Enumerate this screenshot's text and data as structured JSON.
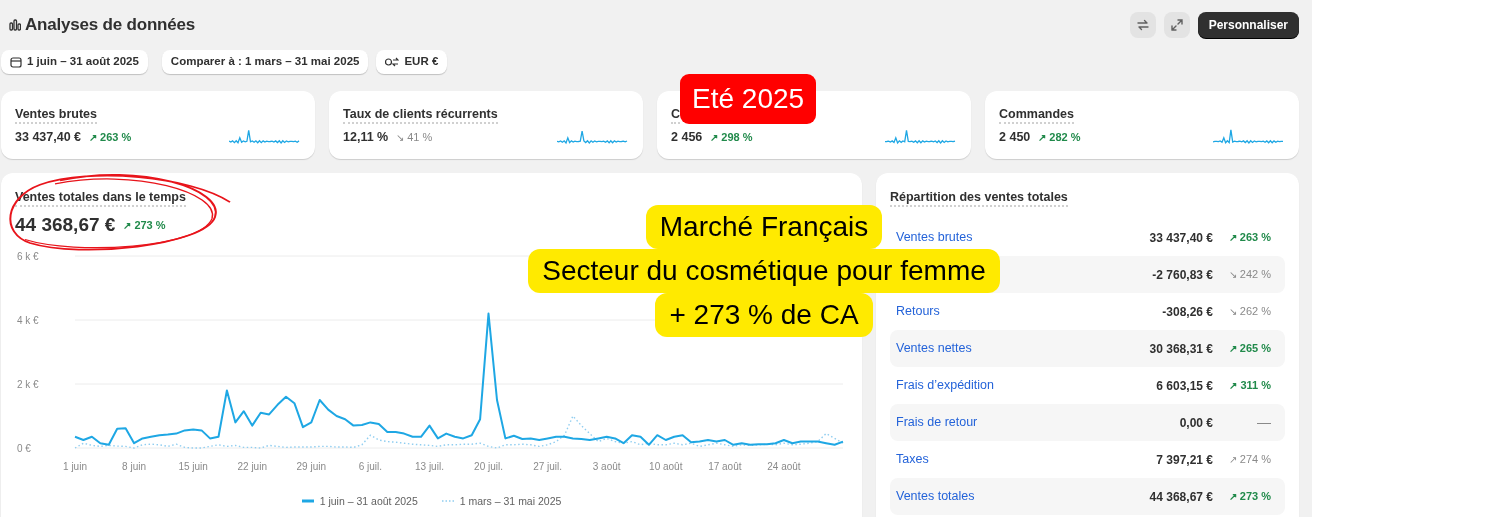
{
  "header": {
    "title": "Analyses de données",
    "action_button": "Personnaliser"
  },
  "filters": [
    {
      "kind": "date",
      "label": "1 juin – 31 août 2025"
    },
    {
      "kind": "plain",
      "label": "Comparer à : 1 mars – 31 mai 2025"
    },
    {
      "kind": "currency",
      "label": "EUR €"
    }
  ],
  "kpis": [
    {
      "title": "Ventes brutes",
      "value": "33 437,40 €",
      "arrow": "↗",
      "change": "263 %",
      "positive": true
    },
    {
      "title": "Taux de clients récurrents",
      "value": "12,11 %",
      "arrow": "↘",
      "change": "41 %",
      "positive": false
    },
    {
      "title": "C",
      "value": "2 456",
      "arrow": "↗",
      "change": "298 %",
      "positive": true
    },
    {
      "title": "Commandes",
      "value": "2 450",
      "arrow": "↗",
      "change": "282 %",
      "positive": true
    }
  ],
  "sales_chart": {
    "title": "Ventes totales dans le temps",
    "value": "44 368,67 €",
    "arrow": "↗",
    "change": "273 %",
    "positive": true,
    "chart_data": {
      "type": "line",
      "ylim": [
        0,
        6000
      ],
      "yticks": [
        {
          "value": 0,
          "label": "0 €"
        },
        {
          "value": 2000,
          "label": "2 k €"
        },
        {
          "value": 4000,
          "label": "4 k €"
        },
        {
          "value": 6000,
          "label": "6 k €"
        }
      ],
      "categories": [
        "1 juin",
        null,
        null,
        null,
        null,
        null,
        null,
        "8 juin",
        null,
        null,
        null,
        null,
        null,
        null,
        "15 juin",
        null,
        null,
        null,
        null,
        null,
        null,
        "22 juin",
        null,
        null,
        null,
        null,
        null,
        null,
        "29 juin",
        null,
        null,
        null,
        null,
        null,
        null,
        "6 juil.",
        null,
        null,
        null,
        null,
        null,
        null,
        "13 juil.",
        null,
        null,
        null,
        null,
        null,
        null,
        "20 juil.",
        null,
        null,
        null,
        null,
        null,
        null,
        "27 juil.",
        null,
        null,
        null,
        null,
        null,
        null,
        "3 août",
        null,
        null,
        null,
        null,
        null,
        null,
        "10 août",
        null,
        null,
        null,
        null,
        null,
        null,
        "17 août",
        null,
        null,
        null,
        null,
        null,
        null,
        "24 août",
        null,
        null,
        null,
        null,
        null,
        null,
        null
      ],
      "series": [
        {
          "name": "1 juin – 31 août 2025",
          "color": "#1ea7e4",
          "values": [
            350,
            250,
            350,
            150,
            100,
            600,
            620,
            150,
            300,
            350,
            400,
            420,
            450,
            550,
            580,
            550,
            300,
            350,
            1800,
            800,
            1150,
            700,
            1100,
            1050,
            1350,
            1600,
            1400,
            650,
            800,
            1500,
            1200,
            1000,
            900,
            700,
            720,
            800,
            750,
            500,
            500,
            450,
            350,
            350,
            700,
            300,
            450,
            350,
            300,
            400,
            900,
            4200,
            1500,
            300,
            380,
            280,
            300,
            250,
            300,
            350,
            350,
            300,
            280,
            250,
            300,
            350,
            300,
            150,
            400,
            350,
            100,
            400,
            250,
            350,
            400,
            180,
            200,
            250,
            200,
            250,
            100,
            150,
            100,
            120,
            120,
            150,
            250,
            150,
            200,
            200,
            200,
            150,
            100,
            200
          ]
        },
        {
          "name": "1 mars – 31 mai 2025",
          "color": "#8fcdf0",
          "line_style": "dotted",
          "values": [
            0,
            150,
            80,
            50,
            80,
            60,
            50,
            0,
            100,
            120,
            100,
            50,
            120,
            20,
            0,
            0,
            50,
            100,
            50,
            80,
            20,
            20,
            0,
            80,
            50,
            20,
            30,
            30,
            30,
            50,
            50,
            30,
            30,
            20,
            100,
            400,
            250,
            200,
            180,
            150,
            120,
            100,
            80,
            50,
            100,
            100,
            120,
            120,
            150,
            50,
            0,
            100,
            100,
            120,
            100,
            50,
            100,
            200,
            400,
            1000,
            700,
            450,
            200,
            300,
            200,
            150,
            200,
            100,
            150,
            100,
            100,
            150,
            100,
            150,
            50,
            100,
            150,
            100,
            50,
            100,
            80,
            100,
            120,
            100,
            150,
            100,
            120,
            150,
            200,
            450,
            300,
            150
          ]
        }
      ]
    }
  },
  "breakdown": {
    "title": "Répartition des ventes totales",
    "rows": [
      {
        "label": "Ventes brutes",
        "value": "33 437,40 €",
        "arrow": "↗",
        "change": "263 %",
        "positive": true
      },
      {
        "value": "-2 760,83 €",
        "arrow": "↘",
        "change": "242 %",
        "positive": false
      },
      {
        "label": "Retours",
        "value": "-308,26 €",
        "arrow": "↘",
        "change": "262 %",
        "positive": false
      },
      {
        "label": "Ventes nettes",
        "value": "30 368,31 €",
        "arrow": "↗",
        "change": "265 %",
        "positive": true
      },
      {
        "label": "Frais d’expédition",
        "value": "6 603,15 €",
        "arrow": "↗",
        "change": "311 %",
        "positive": true
      },
      {
        "label": "Frais de retour",
        "value": "0,00 €",
        "change": "—",
        "positive": false
      },
      {
        "label": "Taxes",
        "value": "7 397,21 €",
        "arrow": "↗",
        "change": "274 %",
        "positive": false
      },
      {
        "label": "Ventes totales",
        "value": "44 368,67 €",
        "arrow": "↗",
        "change": "273 %",
        "positive": true
      }
    ]
  },
  "annotations": [
    {
      "kind": "tag",
      "text": "Eté 2025"
    },
    {
      "kind": "callout",
      "lines": [
        "Marché Français",
        "Secteur du cosmétique pour femme",
        "+ 273 % de CA"
      ]
    },
    {
      "kind": "circle"
    }
  ]
}
